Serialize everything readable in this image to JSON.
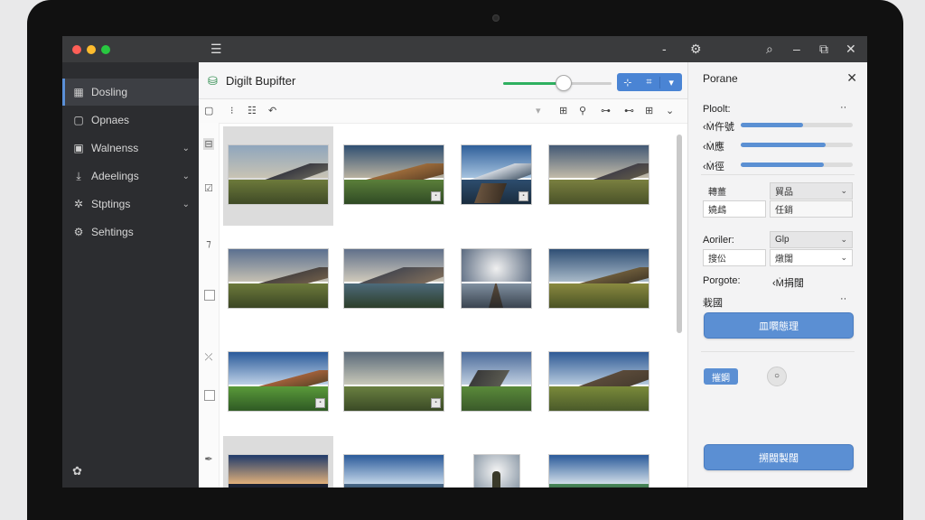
{
  "titlebar": {
    "icons": [
      "menu-icon",
      "minimize-dash-icon",
      "gear-icon",
      "search-icon",
      "minimize-icon",
      "restore-icon",
      "close-icon"
    ],
    "traffic_colors": [
      "#ff5f57",
      "#febc2e",
      "#28c840"
    ]
  },
  "sidebar": {
    "items": [
      {
        "label": "Dosling",
        "icon": "grid-icon",
        "chevron": false,
        "active": true
      },
      {
        "label": "Opnaes",
        "icon": "doc-icon",
        "chevron": false,
        "active": false
      },
      {
        "label": "Walnenss",
        "icon": "image-icon",
        "chevron": true,
        "active": false
      },
      {
        "label": "Adeelings",
        "icon": "download-icon",
        "chevron": true,
        "active": false
      },
      {
        "label": "Stptings",
        "icon": "settings-cog-icon",
        "chevron": true,
        "active": false
      },
      {
        "label": "Sehtings",
        "icon": "gear-icon",
        "chevron": false,
        "active": false
      }
    ]
  },
  "main": {
    "title": "Digilt Bupifter",
    "zoom_fraction": 0.55
  },
  "panel": {
    "title": "Porane",
    "row1_label": "Ploolt:",
    "sliders": [
      {
        "label": "‹Ṁ仵號",
        "value": 0.56
      },
      {
        "label": "‹Ṁ應",
        "value": 0.76
      },
      {
        "label": "‹Ṁ徑",
        "value": 0.74
      }
    ],
    "fields1": [
      {
        "label": "轉薑",
        "value": "嬈䳄",
        "select": "貿品"
      },
      {
        "value": "任銷"
      }
    ],
    "row_aoriler_label": "Aoriler:",
    "aoriler_select": "Glp",
    "aoriler_input": "搜伀",
    "aoriler_select2": "燉闊",
    "porgote_label": "Porgote:",
    "porgote_value": "‹Ṁ捐闊",
    "misc_label": "栽國",
    "button1": "皿嚪態理",
    "small_button": "摧鋼",
    "button2": "搠閥製闊"
  }
}
